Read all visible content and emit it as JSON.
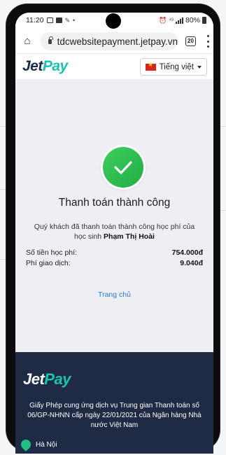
{
  "status_bar": {
    "time": "11:20",
    "battery": "80%"
  },
  "browser": {
    "url": "tdcwebsitepayment.jetpay.vn",
    "tab_count": "20"
  },
  "site": {
    "logo_jet": "Jet",
    "logo_pay": "Pay",
    "language": "Tiếng việt"
  },
  "result": {
    "title": "Thanh toán thành công",
    "description": "Quý khách đã thanh toán thành công học phí của học sinh",
    "student_name": "Phạm Thị Hoài",
    "fee_label": "Số tiền học phí:",
    "fee_value": "754.000đ",
    "transaction_fee_label": "Phí giao dịch:",
    "transaction_fee_value": "9.040đ",
    "home_link": "Trang chủ"
  },
  "footer": {
    "license": "Giấy Phép cung ứng dịch vụ Trung gian Thanh toán số 06/GP-NHNN cấp ngày 22/01/2021 của Ngân hàng Nhà nước Việt Nam",
    "address": "Hà Nội"
  },
  "colors": {
    "brand_navy": "#1d2b4f",
    "brand_teal": "#19c3b0",
    "success_green": "#2bbf52",
    "link_blue": "#2c79d6",
    "footer_bg": "#1f2a45"
  },
  "icons": {
    "home": "home-icon",
    "lock": "lock-icon",
    "tabs": "tabs-icon",
    "menu": "more-vert-icon",
    "flag": "vietnam-flag-icon",
    "success": "check-circle-icon",
    "address": "location-pin-icon"
  }
}
